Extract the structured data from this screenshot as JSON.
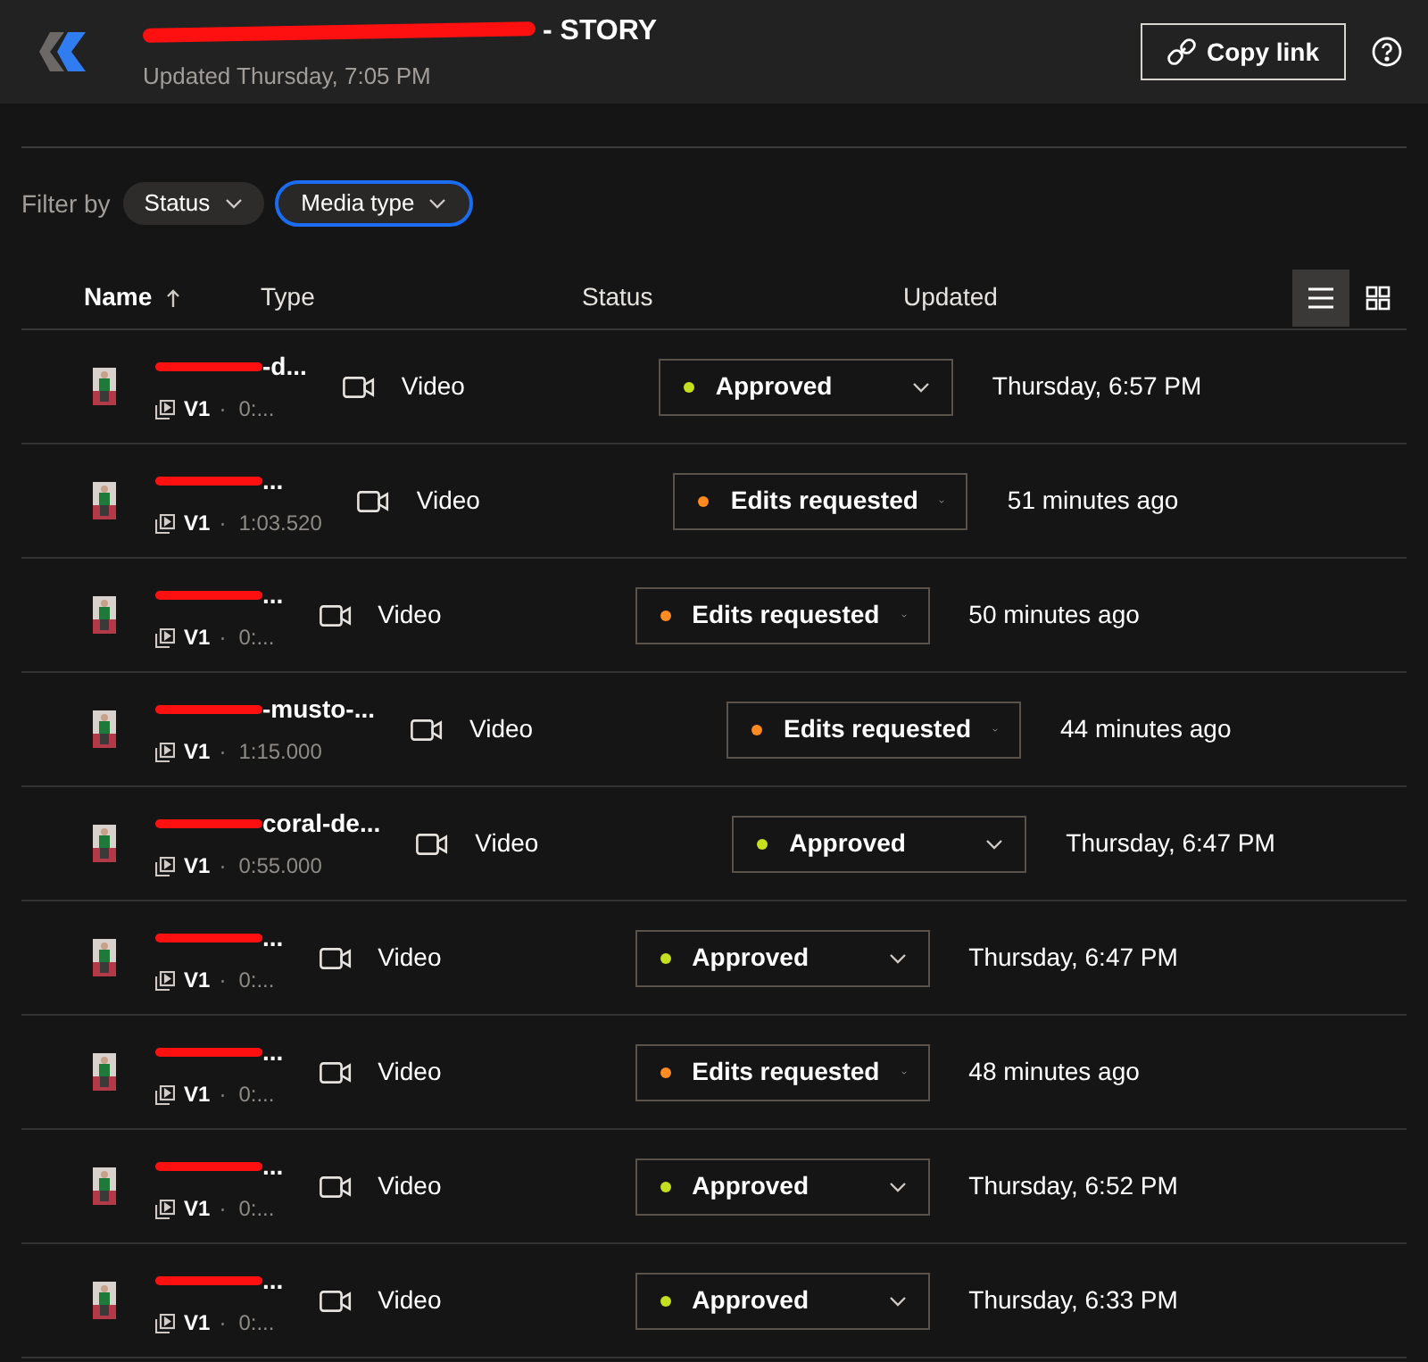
{
  "header": {
    "title": "- STORY",
    "subtitle": "Updated Thursday, 7:05 PM",
    "copy_button": "Copy link"
  },
  "filters": {
    "label": "Filter by",
    "chips": [
      {
        "label": "Status",
        "selected": false
      },
      {
        "label": "Media type",
        "selected": true
      }
    ]
  },
  "table": {
    "columns": [
      {
        "label": "Name",
        "sorted": true
      },
      {
        "label": "Type",
        "sorted": false
      },
      {
        "label": "Status",
        "sorted": false
      },
      {
        "label": "Updated",
        "sorted": false
      }
    ],
    "view_toggle": [
      {
        "kind": "list",
        "selected": true
      },
      {
        "kind": "grid",
        "selected": false
      }
    ],
    "rows": [
      {
        "name": "-d...",
        "version": "V1",
        "separator": "·",
        "duration": "0:...",
        "type": "Video",
        "status": "Approved",
        "color": "#c5e01f",
        "updated": "Thursday, 6:57 PM"
      },
      {
        "name": "...",
        "version": "V1",
        "separator": "·",
        "duration": "1:03.520",
        "type": "Video",
        "status": "Edits requested",
        "color": "#ff8a1f",
        "updated": "51 minutes ago"
      },
      {
        "name": "...",
        "version": "V1",
        "separator": "·",
        "duration": "0:...",
        "type": "Video",
        "status": "Edits requested",
        "color": "#ff8a1f",
        "updated": "50 minutes ago"
      },
      {
        "name": "-musto-...",
        "version": "V1",
        "separator": "·",
        "duration": "1:15.000",
        "type": "Video",
        "status": "Edits requested",
        "color": "#ff8a1f",
        "updated": "44 minutes ago"
      },
      {
        "name": "coral-de...",
        "version": "V1",
        "separator": "·",
        "duration": "0:55.000",
        "type": "Video",
        "status": "Approved",
        "color": "#c5e01f",
        "updated": "Thursday, 6:47 PM"
      },
      {
        "name": "...",
        "version": "V1",
        "separator": "·",
        "duration": "0:...",
        "type": "Video",
        "status": "Approved",
        "color": "#c5e01f",
        "updated": "Thursday, 6:47 PM"
      },
      {
        "name": "...",
        "version": "V1",
        "separator": "·",
        "duration": "0:...",
        "type": "Video",
        "status": "Edits requested",
        "color": "#ff8a1f",
        "updated": "48 minutes ago"
      },
      {
        "name": "...",
        "version": "V1",
        "separator": "·",
        "duration": "0:...",
        "type": "Video",
        "status": "Approved",
        "color": "#c5e01f",
        "updated": "Thursday, 6:52 PM"
      },
      {
        "name": "...",
        "version": "V1",
        "separator": "·",
        "duration": "0:...",
        "type": "Video",
        "status": "Approved",
        "color": "#c5e01f",
        "updated": "Thursday, 6:33 PM"
      }
    ]
  }
}
